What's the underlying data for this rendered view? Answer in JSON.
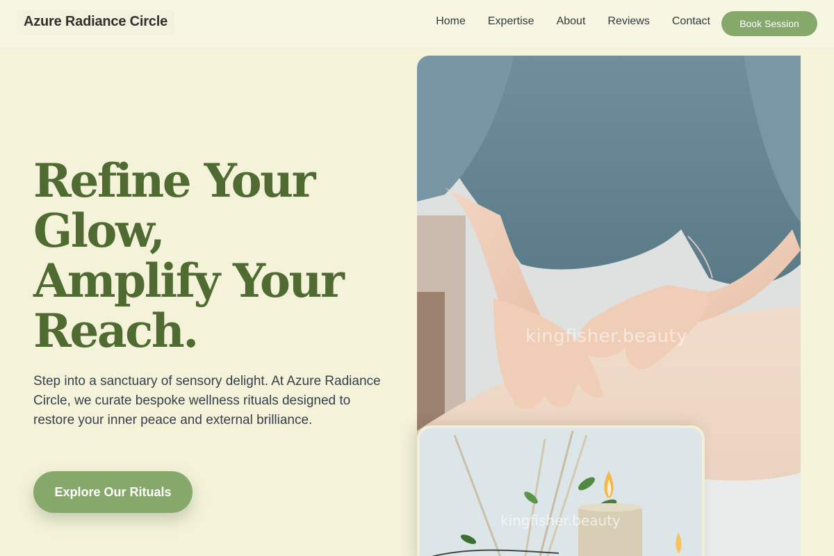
{
  "nav": {
    "brand": "Azure Radiance Circle",
    "links": [
      "Home",
      "Expertise",
      "About",
      "Reviews",
      "Contact"
    ],
    "book_label": "Book Session"
  },
  "hero": {
    "title_lines": [
      "Refine Your",
      "Glow,",
      "Amplify Your",
      "Reach."
    ],
    "description": "Step into a sanctuary of sensory delight. At Azure Radiance Circle, we curate bespoke wellness rituals designed to restore your inner peace and external brilliance.",
    "cta_label": "Explore Our Rituals"
  },
  "images": {
    "main_watermark": "kingfisher.beauty",
    "secondary_watermark": "kingfisher.beauty"
  },
  "colors": {
    "background": "#f4f3da",
    "accent_green": "#86a86a",
    "title_green": "#4f6b32"
  }
}
